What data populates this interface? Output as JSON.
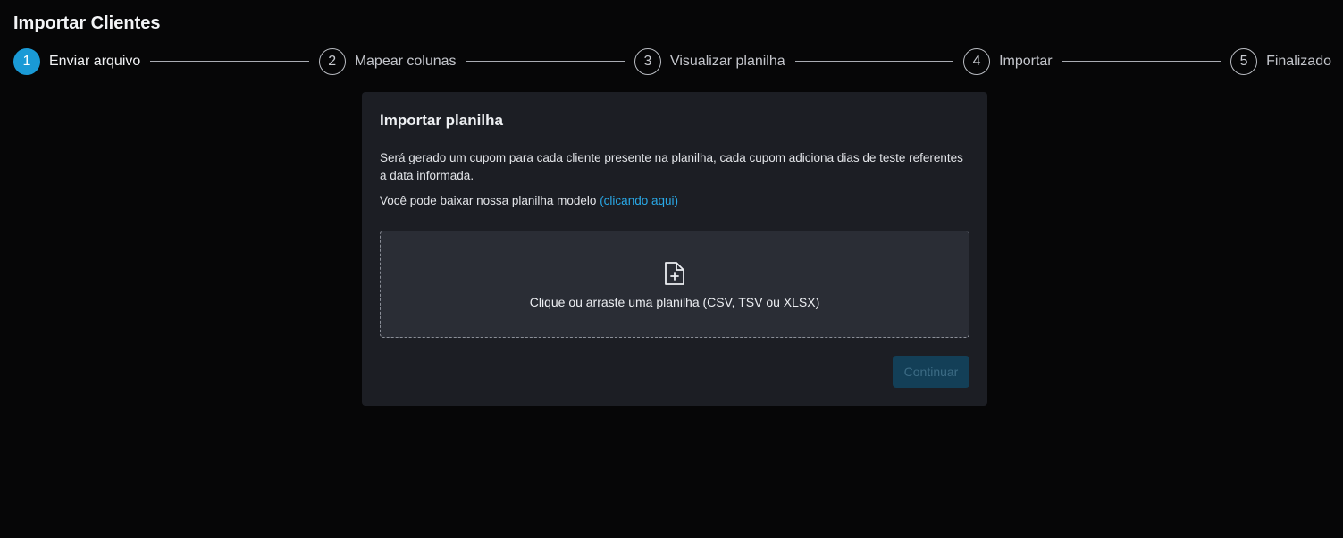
{
  "page": {
    "title": "Importar Clientes"
  },
  "stepper": {
    "steps": [
      {
        "number": "1",
        "label": "Enviar arquivo",
        "active": true
      },
      {
        "number": "2",
        "label": "Mapear colunas",
        "active": false
      },
      {
        "number": "3",
        "label": "Visualizar planilha",
        "active": false
      },
      {
        "number": "4",
        "label": "Importar",
        "active": false
      },
      {
        "number": "5",
        "label": "Finalizado",
        "active": false
      }
    ]
  },
  "card": {
    "title": "Importar planilha",
    "description": "Será gerado um cupom para cada cliente presente na planilha, cada cupom adiciona dias de teste referentes a data informada.",
    "hint_text": "Você pode baixar nossa planilha modelo",
    "hint_link": "(clicando aqui)",
    "dropzone": {
      "icon": "file-plus-icon",
      "text": "Clique ou arraste uma planilha (CSV, TSV ou XLSX)"
    },
    "continue_label": "Continuar"
  },
  "colors": {
    "accent": "#1a9ad6",
    "link": "#29a8e6",
    "background": "#060607",
    "card": "#1c1e24",
    "button_disabled": "#133f57"
  }
}
